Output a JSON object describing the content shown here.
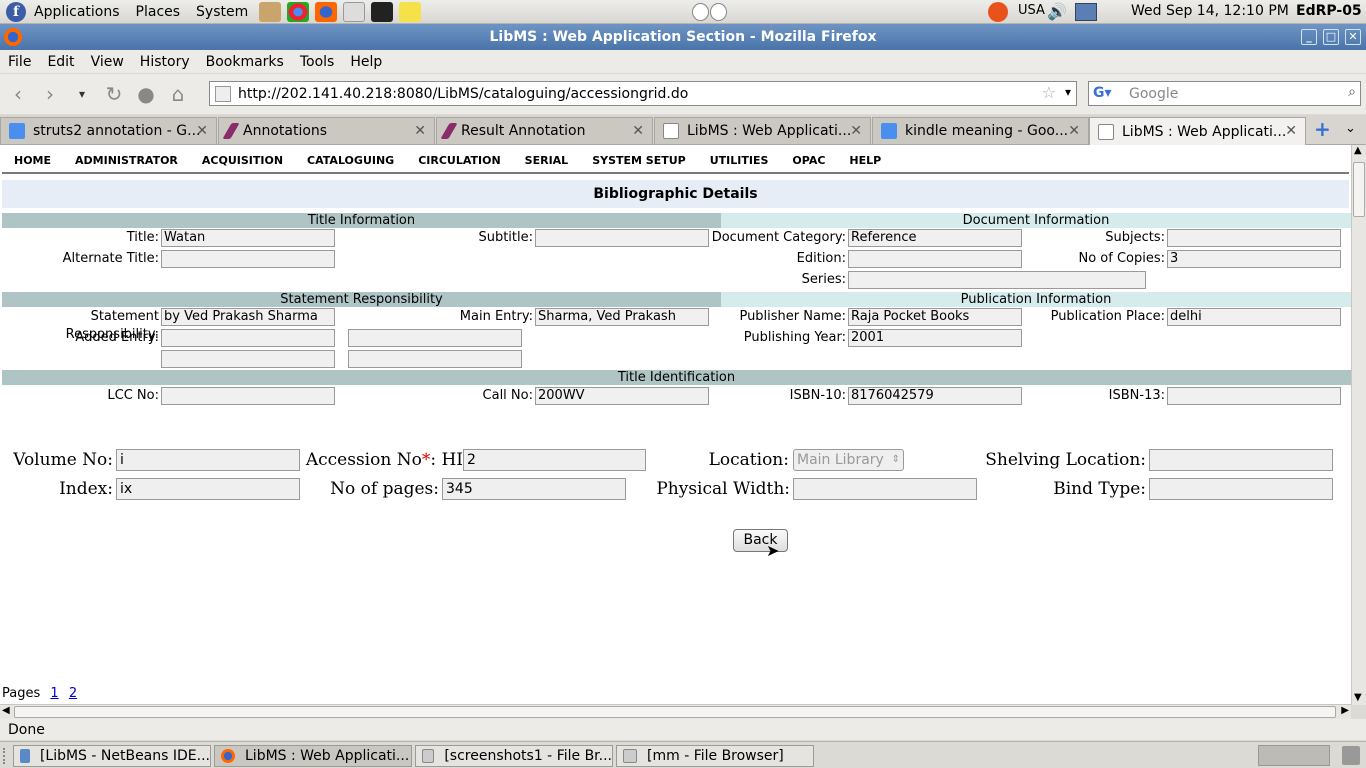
{
  "panel": {
    "menus": [
      "Applications",
      "Places",
      "System"
    ],
    "keyboard": "USA",
    "clock": "Wed Sep 14, 12:10 PM",
    "hostname": "EdRP-05"
  },
  "window": {
    "title": "LibMS : Web Application Section - Mozilla Firefox"
  },
  "menubar": [
    "File",
    "Edit",
    "View",
    "History",
    "Bookmarks",
    "Tools",
    "Help"
  ],
  "navbar": {
    "url": "http://202.141.40.218:8080/LibMS/cataloguing/accessiongrid.do",
    "search_placeholder": "Google"
  },
  "tabs": [
    {
      "label": "struts2 annotation - G..."
    },
    {
      "label": "Annotations"
    },
    {
      "label": "Result Annotation"
    },
    {
      "label": "LibMS : Web Applicati..."
    },
    {
      "label": "kindle meaning - Goo..."
    },
    {
      "label": "LibMS : Web Applicati..."
    }
  ],
  "appnav": [
    "HOME",
    "ADMINISTRATOR",
    "ACQUISITION",
    "CATALOGUING",
    "CIRCULATION",
    "SERIAL",
    "SYSTEM SETUP",
    "UTILITIES",
    "OPAC",
    "HELP"
  ],
  "page": {
    "heading": "Bibliographic Details",
    "sections": {
      "title_info": "Title Information",
      "doc_info": "Document Information",
      "stmt_resp": "Statement Responsibility",
      "pub_info": "Publication Information",
      "title_ident": "Title Identification"
    },
    "labels": {
      "title": "Title:",
      "subtitle": "Subtitle:",
      "doc_category": "Document Category:",
      "subjects": "Subjects:",
      "alt_title": "Alternate Title:",
      "edition": "Edition:",
      "no_copies": "No of Copies:",
      "series": "Series:",
      "stmt_resp": "Statement Responsibility:",
      "main_entry": "Main Entry:",
      "publisher": "Publisher Name:",
      "pub_place": "Publication Place:",
      "added_entry": "Added Entry:",
      "pub_year": "Publishing Year:",
      "lcc": "LCC No:",
      "call_no": "Call No:",
      "isbn10": "ISBN-10:",
      "isbn13": "ISBN-13:"
    },
    "values": {
      "title": "Watan",
      "subtitle": "",
      "doc_category": "Reference",
      "subjects": "",
      "alt_title": "",
      "edition": "",
      "no_copies": "3",
      "series": "",
      "stmt_resp": "by Ved Prakash Sharma",
      "main_entry": "Sharma, Ved Prakash",
      "publisher": "Raja Pocket Books",
      "pub_place": "delhi",
      "pub_year": "2001",
      "lcc": "",
      "call_no": "200WV",
      "isbn10": "8176042579",
      "isbn13": ""
    },
    "accession": {
      "labels": {
        "volume": "Volume No:",
        "accession": "Accession No",
        "required": "*",
        "colon": ":",
        "prefix": "HI",
        "location": "Location:",
        "shelving": "Shelving Location:",
        "index": "Index:",
        "pages": "No of pages:",
        "width": "Physical Width:",
        "bind": "Bind Type:"
      },
      "values": {
        "volume": "i",
        "accession": "2",
        "location": "Main Library",
        "shelving": "",
        "index": "ix",
        "pages": "345",
        "width": "",
        "bind": ""
      }
    },
    "back_label": "Back",
    "pages_label": "Pages",
    "page_links": [
      "1",
      "2"
    ]
  },
  "status": "Done",
  "taskbar": [
    {
      "label": "[LibMS - NetBeans IDE..."
    },
    {
      "label": "LibMS : Web Applicati..."
    },
    {
      "label": "[screenshots1 - File Br..."
    },
    {
      "label": "[mm - File Browser]"
    }
  ]
}
